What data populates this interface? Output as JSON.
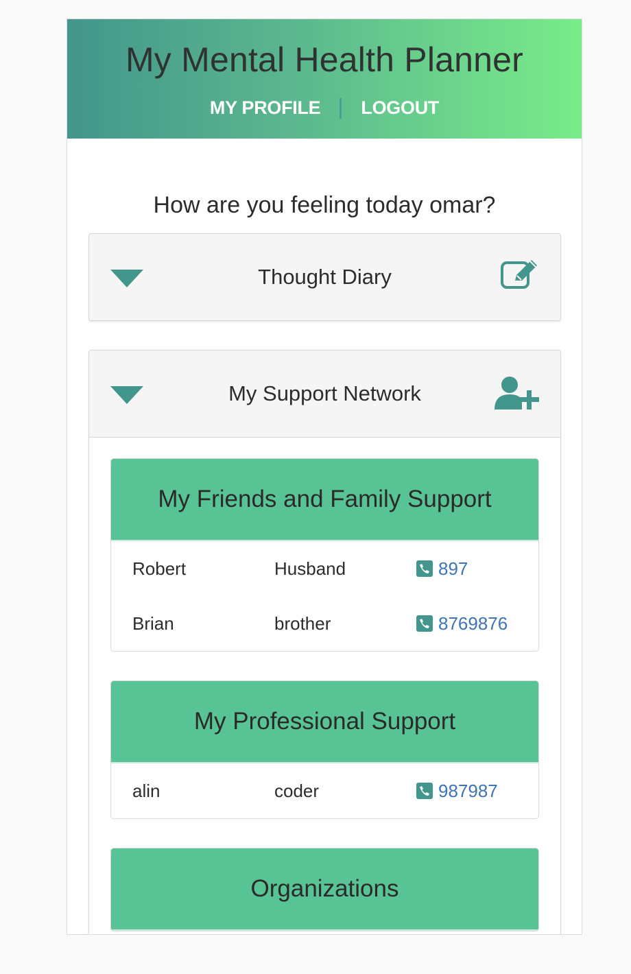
{
  "header": {
    "app_title": "My Mental Health Planner",
    "nav": {
      "profile": "MY PROFILE",
      "logout": "LOGOUT"
    }
  },
  "greeting": "How are you feeling today omar?",
  "thought_diary": {
    "title": "Thought Diary",
    "icon": "edit-icon"
  },
  "support_network": {
    "title": "My Support Network",
    "icon": "add-user-icon",
    "friends_family": {
      "title": "My Friends and Family Support",
      "contacts": [
        {
          "name": "Robert",
          "relation": "Husband",
          "phone": "897"
        },
        {
          "name": "Brian",
          "relation": "brother",
          "phone": "8769876"
        }
      ]
    },
    "professional": {
      "title": "My Professional Support",
      "contacts": [
        {
          "name": "alin",
          "relation": "coder",
          "phone": "987987"
        }
      ]
    },
    "organizations": {
      "title": "Organizations"
    }
  },
  "colors": {
    "header_gradient_start": "#43968b",
    "header_gradient_end": "#79ec89",
    "accent": "#43968b",
    "card_header": "#58c394",
    "link": "#3f74b4"
  }
}
